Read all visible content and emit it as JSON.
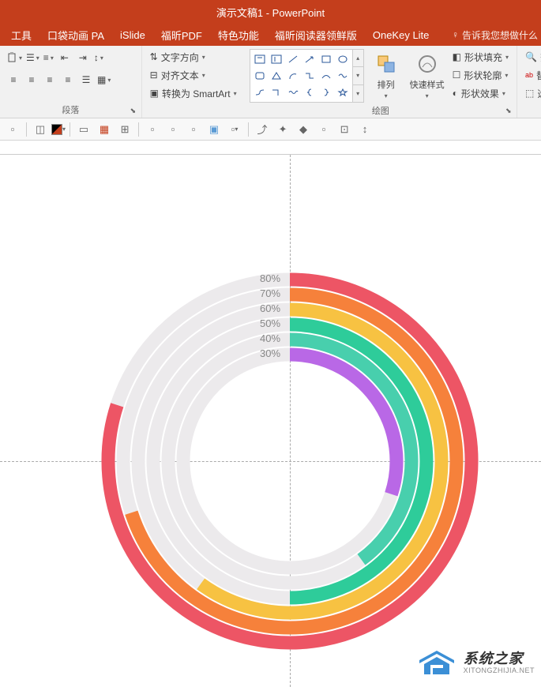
{
  "title": "演示文稿1 - PowerPoint",
  "tabs": [
    "工具",
    "口袋动画 PA",
    "iSlide",
    "福昕PDF",
    "特色功能",
    "福昕阅读器领鲜版",
    "OneKey Lite"
  ],
  "tell_me": "告诉我您想做什么",
  "ribbon": {
    "paragraph": {
      "label": "段落",
      "text_direction": "文字方向",
      "align_text": "对齐文本",
      "convert_smartart": "转换为 SmartArt"
    },
    "drawing": {
      "label": "绘图",
      "arrange": "排列",
      "quick_styles": "快速样式",
      "shape_fill": "形状填充",
      "shape_outline": "形状轮廓",
      "shape_effects": "形状效果"
    },
    "editing": {
      "find": "查",
      "replace": "替",
      "select": "选"
    }
  },
  "chart_data": {
    "type": "radial-bar",
    "series": [
      {
        "label": "80%",
        "value": 80,
        "color": "#ed5565",
        "radius": 230,
        "thickness": 17
      },
      {
        "label": "70%",
        "value": 70,
        "color": "#f6813b",
        "radius": 211,
        "thickness": 17
      },
      {
        "label": "60%",
        "value": 60,
        "color": "#f7c242",
        "radius": 192,
        "thickness": 17
      },
      {
        "label": "50%",
        "value": 50,
        "color": "#2ecc9a",
        "radius": 173,
        "thickness": 17
      },
      {
        "label": "40%",
        "value": 40,
        "color": "#48cfad",
        "radius": 154,
        "thickness": 17
      },
      {
        "label": "30%",
        "value": 30,
        "color": "#b968e6",
        "radius": 135,
        "thickness": 17
      }
    ],
    "track_color": "#eceaec",
    "start_angle": -90
  },
  "watermark": {
    "main": "系统之家",
    "sub": "XITONGZHIJIA.NET"
  }
}
